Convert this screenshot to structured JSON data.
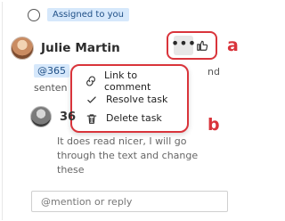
{
  "assigned": {
    "badge": "Assigned to you"
  },
  "comment": {
    "author": "Julie Martin",
    "mention": "@365",
    "peek_right": "nd",
    "peek_sentence": "senten"
  },
  "menu": {
    "items": [
      {
        "label": "Link to comment",
        "icon": "link-icon"
      },
      {
        "label": "Resolve task",
        "icon": "checkmark-icon"
      },
      {
        "label": "Delete task",
        "icon": "trash-icon"
      }
    ]
  },
  "reply": {
    "author_label": "36",
    "text": "It does read nicer, I will go through the text and change these"
  },
  "input": {
    "placeholder": "@mention or reply"
  },
  "callouts": {
    "a": "a",
    "b": "b"
  },
  "colors": {
    "callout_red": "#d9343b",
    "assigned_bg": "#d6e8fb",
    "assigned_text": "#1f4f86"
  }
}
